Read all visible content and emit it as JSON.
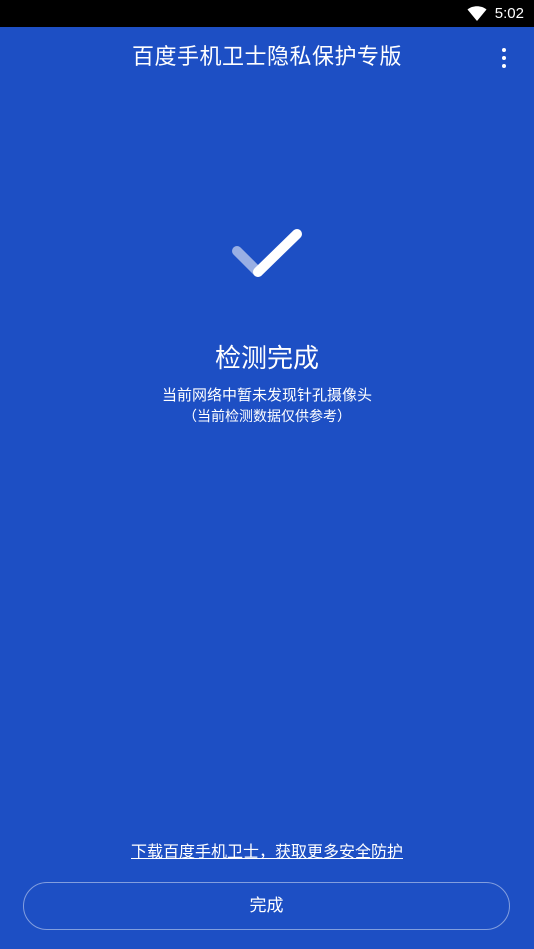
{
  "status_bar": {
    "time": "5:02",
    "wifi_icon": "wifi-icon"
  },
  "header": {
    "title": "百度手机卫士隐私保护专版",
    "more_icon": "more-vertical-icon"
  },
  "result": {
    "icon": "check-icon",
    "title": "检测完成",
    "message": "当前网络中暂未发现针孔摄像头",
    "note": "（当前检测数据仅供参考）"
  },
  "footer": {
    "download_link": "下载百度手机卫士，获取更多安全防护",
    "done_label": "完成"
  },
  "colors": {
    "background": "#1d4fc4",
    "status_bar": "#000000",
    "text": "#ffffff"
  }
}
